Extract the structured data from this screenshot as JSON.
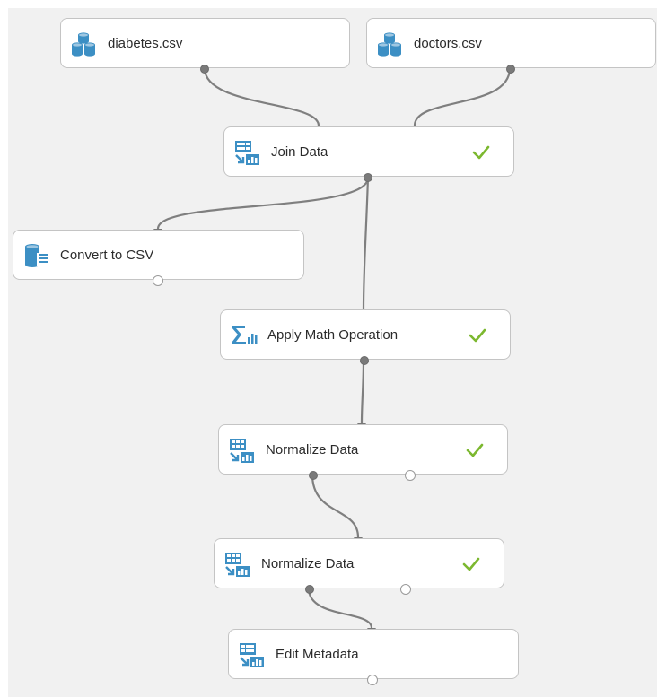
{
  "experiment": {
    "modules": [
      {
        "id": "diabetes",
        "label": "diabetes.csv",
        "icon": "dataset-icon",
        "completed": false
      },
      {
        "id": "doctors",
        "label": "doctors.csv",
        "icon": "dataset-icon",
        "completed": false
      },
      {
        "id": "join",
        "label": "Join Data",
        "icon": "data-transform-icon",
        "completed": true
      },
      {
        "id": "convert",
        "label": "Convert to CSV",
        "icon": "convert-icon",
        "completed": false
      },
      {
        "id": "math",
        "label": "Apply Math Operation",
        "icon": "math-operation-icon",
        "completed": true
      },
      {
        "id": "normalize1",
        "label": "Normalize Data",
        "icon": "data-transform-icon",
        "completed": true
      },
      {
        "id": "normalize2",
        "label": "Normalize Data",
        "icon": "data-transform-icon",
        "completed": true
      },
      {
        "id": "metadata",
        "label": "Edit Metadata",
        "icon": "data-transform-icon",
        "completed": false
      }
    ],
    "connections": [
      {
        "from": "diabetes",
        "to": "join"
      },
      {
        "from": "doctors",
        "to": "join"
      },
      {
        "from": "join",
        "to": "convert"
      },
      {
        "from": "join",
        "to": "math"
      },
      {
        "from": "math",
        "to": "normalize1"
      },
      {
        "from": "normalize1",
        "to": "normalize2"
      },
      {
        "from": "normalize2",
        "to": "metadata"
      }
    ]
  },
  "colors": {
    "icon_blue": "#3c8fc4",
    "check_green": "#7cb82f",
    "wire": "#7f7f7f",
    "canvas": "#f1f1f1"
  }
}
